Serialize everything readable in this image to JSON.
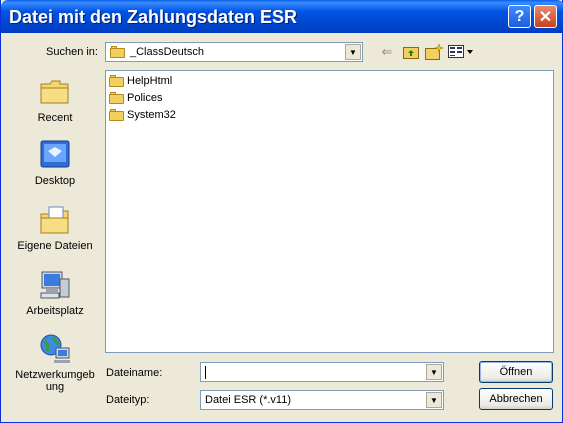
{
  "window": {
    "title": "Datei mit den Zahlungsdaten ESR",
    "help_label": "?",
    "close_label": "✕"
  },
  "lookin": {
    "label": "Suchen in:",
    "value": "_ClassDeutsch"
  },
  "places": [
    {
      "label": "Recent",
      "icon": "recent-folder-icon"
    },
    {
      "label": "Desktop",
      "icon": "desktop-icon"
    },
    {
      "label": "Eigene Dateien",
      "icon": "my-documents-icon"
    },
    {
      "label": "Arbeitsplatz",
      "icon": "my-computer-icon"
    },
    {
      "label": "Netzwerkumgeb ung",
      "icon": "network-icon"
    }
  ],
  "files": [
    {
      "name": "HelpHtml"
    },
    {
      "name": "Polices"
    },
    {
      "name": "System32"
    }
  ],
  "filename": {
    "label": "Dateiname:",
    "value": ""
  },
  "filetype": {
    "label": "Dateityp:",
    "value": "Datei ESR (*.v11)"
  },
  "buttons": {
    "open": "Öffnen",
    "cancel": "Abbrechen"
  }
}
